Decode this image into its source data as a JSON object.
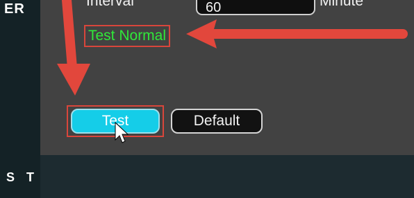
{
  "sidebar": {
    "top_label": "ER",
    "bottom_label": "S T"
  },
  "form": {
    "interval_label": "Interval",
    "interval_value": "60",
    "unit_label": "Minute",
    "status_text": "Test Normal"
  },
  "buttons": {
    "test_label": "Test",
    "default_label": "Default"
  },
  "colors": {
    "status_green": "#30e83a",
    "test_button": "#15cde8",
    "annotation_red": "#e2473c"
  },
  "icons": {
    "pointer": "mouse-pointer-icon",
    "arrows": [
      "arrow-right-to-left",
      "arrow-top-to-down"
    ]
  }
}
